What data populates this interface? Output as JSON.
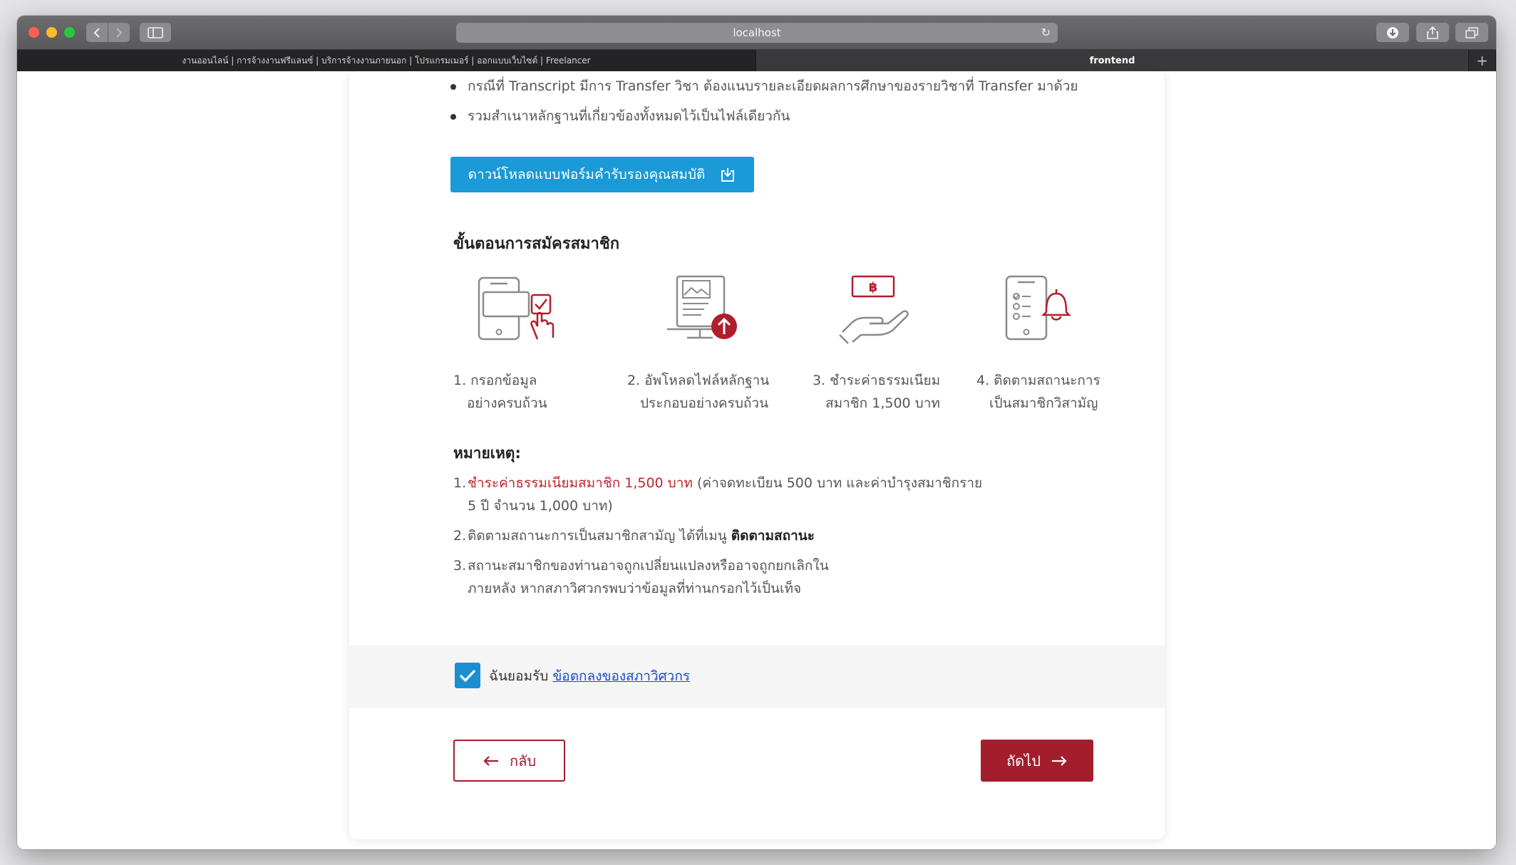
{
  "browser": {
    "url": "localhost",
    "tabs": [
      {
        "label": "งานออนไลน์ | การจ้างงานฟรีแลนซ์ | บริการจ้างงานภายนอก | โปรแกรมเมอร์ | ออกแบบเว็บไซต์ | Freelancer"
      },
      {
        "label": "frontend"
      }
    ]
  },
  "requirements": {
    "bullets": [
      "กรณีที่ Transcript มีการ Transfer วิชา ต้องแนบรายละเอียดผลการศึกษาของรายวิชาที่ Transfer มาด้วย",
      "รวมสำเนาหลักฐานที่เกี่ยวข้องทั้งหมดไว้เป็นไฟล์เดียวกัน"
    ],
    "download_label": "ดาวน์โหลดแบบฟอร์มคำรับรองคุณสมบัติ"
  },
  "steps": {
    "title": "ขั้นตอนการสมัครสมาชิก",
    "items": [
      {
        "line1": "1. กรอกข้อมูล",
        "line2": "อย่างครบถ้วน"
      },
      {
        "line1": "2. อัพโหลดไฟล์หลักฐาน",
        "line2": "ประกอบอย่างครบถ้วน"
      },
      {
        "line1": "3. ชำระค่าธรรมเนียม",
        "line2": "สมาชิก 1,500 บาท"
      },
      {
        "line1": "4. ติดตามสถานะการ",
        "line2": "เป็นสมาชิกวิสามัญ"
      }
    ]
  },
  "notes": {
    "title": "หมายเหตุ:",
    "n1_num": "1.",
    "n1_red": "ชำระค่าธรรมเนียมสมาชิก 1,500 บาท",
    "n1_rest": " (ค่าจดทะเบียน 500 บาท และค่าบำรุงสมาชิกราย 5 ปี จำนวน 1,000 บาท)",
    "n2_num": "2.",
    "n2_text": "ติดตามสถานะการเป็นสมาชิกสามัญ ได้ที่เมนู ",
    "n2_bold": "ติดตามสถานะ",
    "n3_num": "3.",
    "n3_text": "สถานะสมาชิกของท่านอาจถูกเปลี่ยนแปลงหรืออาจถูกยกเลิกในภายหลัง หากสภาวิศวกรพบว่าข้อมูลที่ท่านกรอกไว้เป็นเท็จ"
  },
  "agreement": {
    "checked": true,
    "text": "ฉันยอมรับ ",
    "link": "ข้อตกลงของสภาวิศวกร"
  },
  "nav": {
    "back_label": "กลับ",
    "next_label": "ถัดไป"
  },
  "colors": {
    "accent_red": "#a31d2c",
    "accent_blue": "#1a9ad6"
  }
}
